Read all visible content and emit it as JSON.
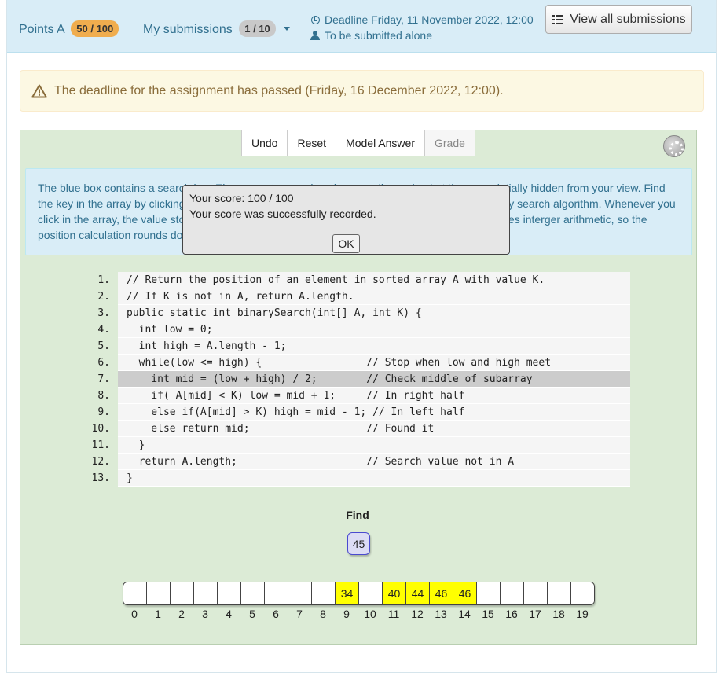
{
  "header": {
    "points_label": "Points A",
    "points_badge": "50 / 100",
    "submissions_label": "My submissions",
    "submissions_badge": "1 / 10",
    "deadline": "Deadline Friday, 11 November 2022, 12:00",
    "submission_mode": "To be submitted alone",
    "view_all_label": "View all submissions"
  },
  "alert": {
    "text": "The deadline for the assignment has passed (Friday, 16 December 2022, 12:00)."
  },
  "toolbar": {
    "undo": "Undo",
    "reset": "Reset",
    "model_answer": "Model Answer",
    "grade": "Grade"
  },
  "instructions": "The blue box contains a search key. The array stores values in ascending order, but these are intially hidden from your view. Find the key in the array by clicking on the midpoint positions as they would be calculated by the binary search algorithm. Whenever you click in the array, the value stored there will be displayed. Remember that midpoint calculation uses interger arithmetic, so the position calculation rounds down.",
  "code": [
    {
      "n": "1.",
      "t": "// Return the position of an element in sorted array A with value K."
    },
    {
      "n": "2.",
      "t": "// If K is not in A, return A.length."
    },
    {
      "n": "3.",
      "t": "public static int binarySearch(int[] A, int K) {"
    },
    {
      "n": "4.",
      "t": "  int low = 0;"
    },
    {
      "n": "5.",
      "t": "  int high = A.length - 1;"
    },
    {
      "n": "6.",
      "t": "  while(low <= high) {                 // Stop when low and high meet"
    },
    {
      "n": "7.",
      "t": "    int mid = (low + high) / 2;        // Check middle of subarray"
    },
    {
      "n": "8.",
      "t": "    if( A[mid] < K) low = mid + 1;     // In right half"
    },
    {
      "n": "9.",
      "t": "    else if(A[mid] > K) high = mid - 1; // In left half"
    },
    {
      "n": "10.",
      "t": "    else return mid;                   // Found it"
    },
    {
      "n": "11.",
      "t": "  }"
    },
    {
      "n": "12.",
      "t": "  return A.length;                     // Search value not in A"
    },
    {
      "n": "13.",
      "t": "}"
    }
  ],
  "highlight_line": "7.",
  "dialog": {
    "score": "Your score: 100 / 100",
    "message": "Your score was successfully recorded.",
    "ok": "OK"
  },
  "find_label": "Find",
  "search_key": "45",
  "array": [
    "",
    "",
    "",
    "",
    "",
    "",
    "",
    "",
    "",
    "34",
    "",
    "40",
    "44",
    "46",
    "46",
    "",
    "",
    "",
    "",
    ""
  ],
  "indices": [
    "0",
    "1",
    "2",
    "3",
    "4",
    "5",
    "6",
    "7",
    "8",
    "9",
    "10",
    "11",
    "12",
    "13",
    "14",
    "15",
    "16",
    "17",
    "18",
    "19"
  ]
}
